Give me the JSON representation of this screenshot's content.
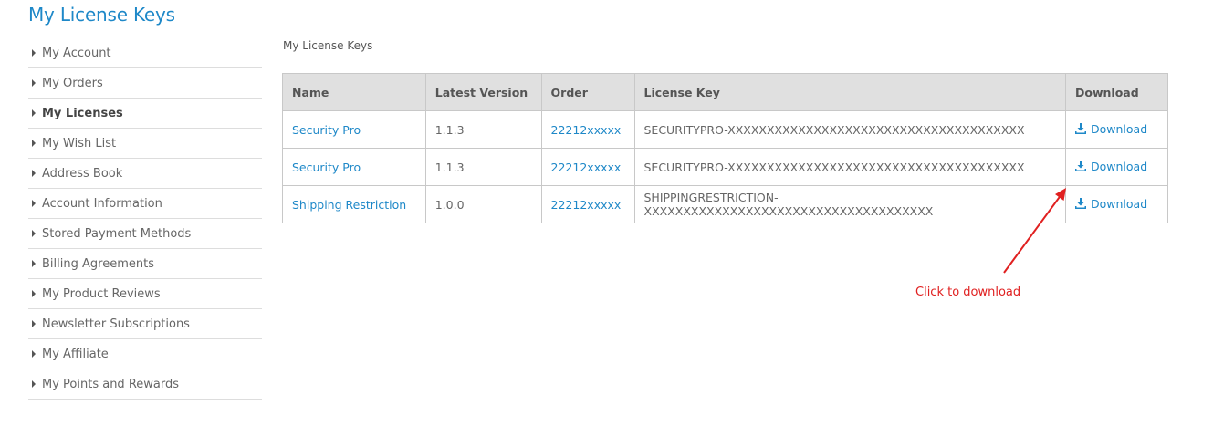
{
  "page_title": "My License Keys",
  "sidebar": {
    "items": [
      {
        "label": "My Account"
      },
      {
        "label": "My Orders"
      },
      {
        "label": "My Licenses"
      },
      {
        "label": "My Wish List"
      },
      {
        "label": "Address Book"
      },
      {
        "label": "Account Information"
      },
      {
        "label": "Stored Payment Methods"
      },
      {
        "label": "Billing Agreements"
      },
      {
        "label": "My Product Reviews"
      },
      {
        "label": "Newsletter Subscriptions"
      },
      {
        "label": "My Affiliate"
      },
      {
        "label": "My Points and Rewards"
      }
    ]
  },
  "main": {
    "section_title": "My License Keys",
    "table": {
      "headers": [
        "Name",
        "Latest Version",
        "Order",
        "License Key",
        "Download"
      ],
      "rows": [
        {
          "name": "Security Pro",
          "version": "1.1.3",
          "order": "22212xxxxx",
          "license_key": "SECURITYPRO-XXXXXXXXXXXXXXXXXXXXXXXXXXXXXXXXXXXXXX",
          "download": "Download"
        },
        {
          "name": "Security Pro",
          "version": "1.1.3",
          "order": "22212xxxxx",
          "license_key": "SECURITYPRO-XXXXXXXXXXXXXXXXXXXXXXXXXXXXXXXXXXXXXX",
          "download": "Download"
        },
        {
          "name": "Shipping Restriction",
          "version": "1.0.0",
          "order": "22212xxxxx",
          "license_key": "SHIPPINGRESTRICTION-XXXXXXXXXXXXXXXXXXXXXXXXXXXXXXXXXXXXX",
          "download": "Download"
        }
      ]
    }
  },
  "annotation": {
    "text": "Click to download",
    "color": "#e02020"
  },
  "colors": {
    "accent": "#1e88c8",
    "header_bg": "#e0e0e0"
  }
}
